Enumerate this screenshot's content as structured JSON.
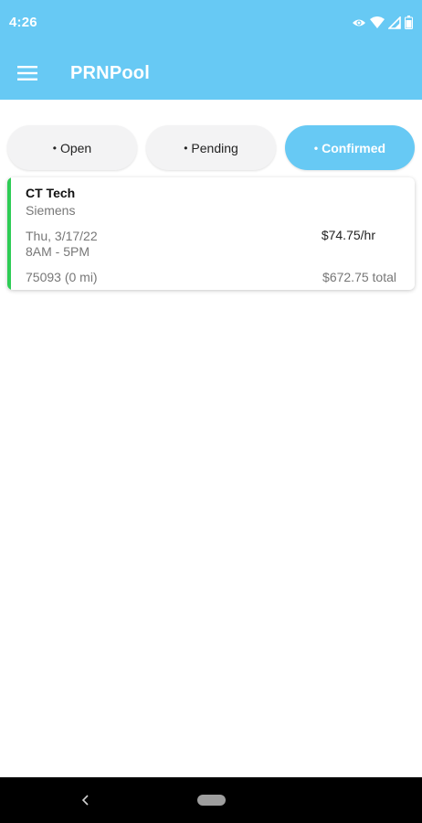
{
  "status_bar": {
    "time": "4:26",
    "icons": [
      "eye-icon",
      "wifi-icon",
      "signal-icon",
      "battery-icon"
    ]
  },
  "app_bar": {
    "title": "PRNPool",
    "menu_icon": "hamburger-menu-icon"
  },
  "filters": {
    "open_label": "Open",
    "pending_label": "Pending",
    "confirmed_label": "Confirmed",
    "bullet": "•",
    "selected": "Confirmed"
  },
  "shifts": [
    {
      "title": "CT Tech",
      "company": "Siemens",
      "date": "Thu, 3/17/22",
      "time": "8AM - 5PM",
      "rate": "$74.75/hr",
      "location": "75093 (0 mi)",
      "total": "$672.75 total",
      "status_color": "#2ecc55"
    }
  ],
  "colors": {
    "brand": "#67c9f4",
    "accent_confirmed": "#2ecc55"
  },
  "nav_bar": {
    "back_icon": "back-chevron-icon",
    "home_icon": "home-pill-icon"
  }
}
